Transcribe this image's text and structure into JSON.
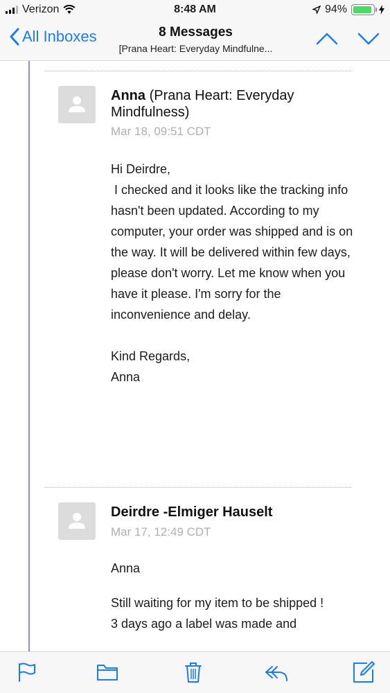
{
  "status_bar": {
    "carrier": "Verizon",
    "time": "8:48 AM",
    "battery": "94%",
    "battery_level": 0.94
  },
  "nav": {
    "back_label": "All Inboxes",
    "title": "8 Messages",
    "subtitle": "[Prana Heart: Everyday Mindfulne..."
  },
  "messages": [
    {
      "sender_name": "Anna",
      "sender_org": "(Prana Heart: Everyday Mindfulness)",
      "date": "Mar 18, 09:51 CDT",
      "paragraphs": [
        "Hi Deirdre,\n I checked and it looks like the tracking info hasn't been updated. According to my computer, your order was shipped and is on the way. It will be delivered within few days, please don't worry. Let me know when you have it please. I'm sorry for the inconvenience and delay.",
        "Kind Regards,\nAnna"
      ]
    },
    {
      "sender_name": "Deirdre -Elmiger Hauselt",
      "date": "Mar 17, 12:49 CDT",
      "paragraphs": [
        "Anna",
        "Still waiting for my item to be shipped !\n3 days ago a label was made and"
      ]
    }
  ],
  "toolbar": {
    "icons": [
      "flag-icon",
      "folder-icon",
      "trash-icon",
      "reply-icon",
      "compose-icon"
    ]
  },
  "colors": {
    "accent": "#1a7cf5",
    "thread_line": "#8a8fd0",
    "date_gray": "#b0b0b0"
  }
}
